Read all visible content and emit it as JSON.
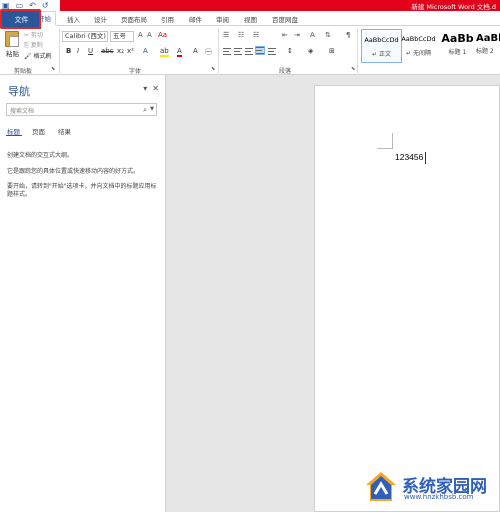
{
  "window": {
    "title": "新建 Microsoft Word 文档.d"
  },
  "tabs": {
    "file": "文件",
    "items": [
      "开始",
      "插入",
      "设计",
      "页面布局",
      "引用",
      "邮件",
      "审阅",
      "视图",
      "百度网盘"
    ]
  },
  "ribbon": {
    "clipboard": {
      "paste": "粘贴",
      "cut": "剪切",
      "copy": "复制",
      "format_painter": "格式刷",
      "label": "剪贴板"
    },
    "font": {
      "font_name": "Calibri (西文)",
      "font_size": "五号",
      "label": "字体"
    },
    "paragraph": {
      "label": "段落"
    },
    "styles": {
      "items": [
        {
          "sample": "AaBbCcDd",
          "name": "↵ 正文"
        },
        {
          "sample": "AaBbCcDd",
          "name": "↵ 无间隔"
        },
        {
          "sample": "AaBb",
          "name": "标题 1"
        },
        {
          "sample": "AaBbC",
          "name": "标题 2"
        }
      ]
    }
  },
  "nav": {
    "title": "导航",
    "search_placeholder": "搜索文档",
    "tabs": [
      "标题",
      "页面",
      "结果"
    ],
    "lines": [
      "创建文档的交互式大纲。",
      "它是跟踪您的具体位置或快速移动内容的好方式。",
      "要开始，请转到\"开始\"选项卡，并向文档中的标题应用标题样式。"
    ]
  },
  "document": {
    "text": "123456"
  },
  "watermark": {
    "name": "系统家园网",
    "url": "www.hnzkhbsb.com"
  },
  "colors": {
    "accent": "#2b579a",
    "titlebar": "#e3001b",
    "highlight": "#e3242b"
  }
}
